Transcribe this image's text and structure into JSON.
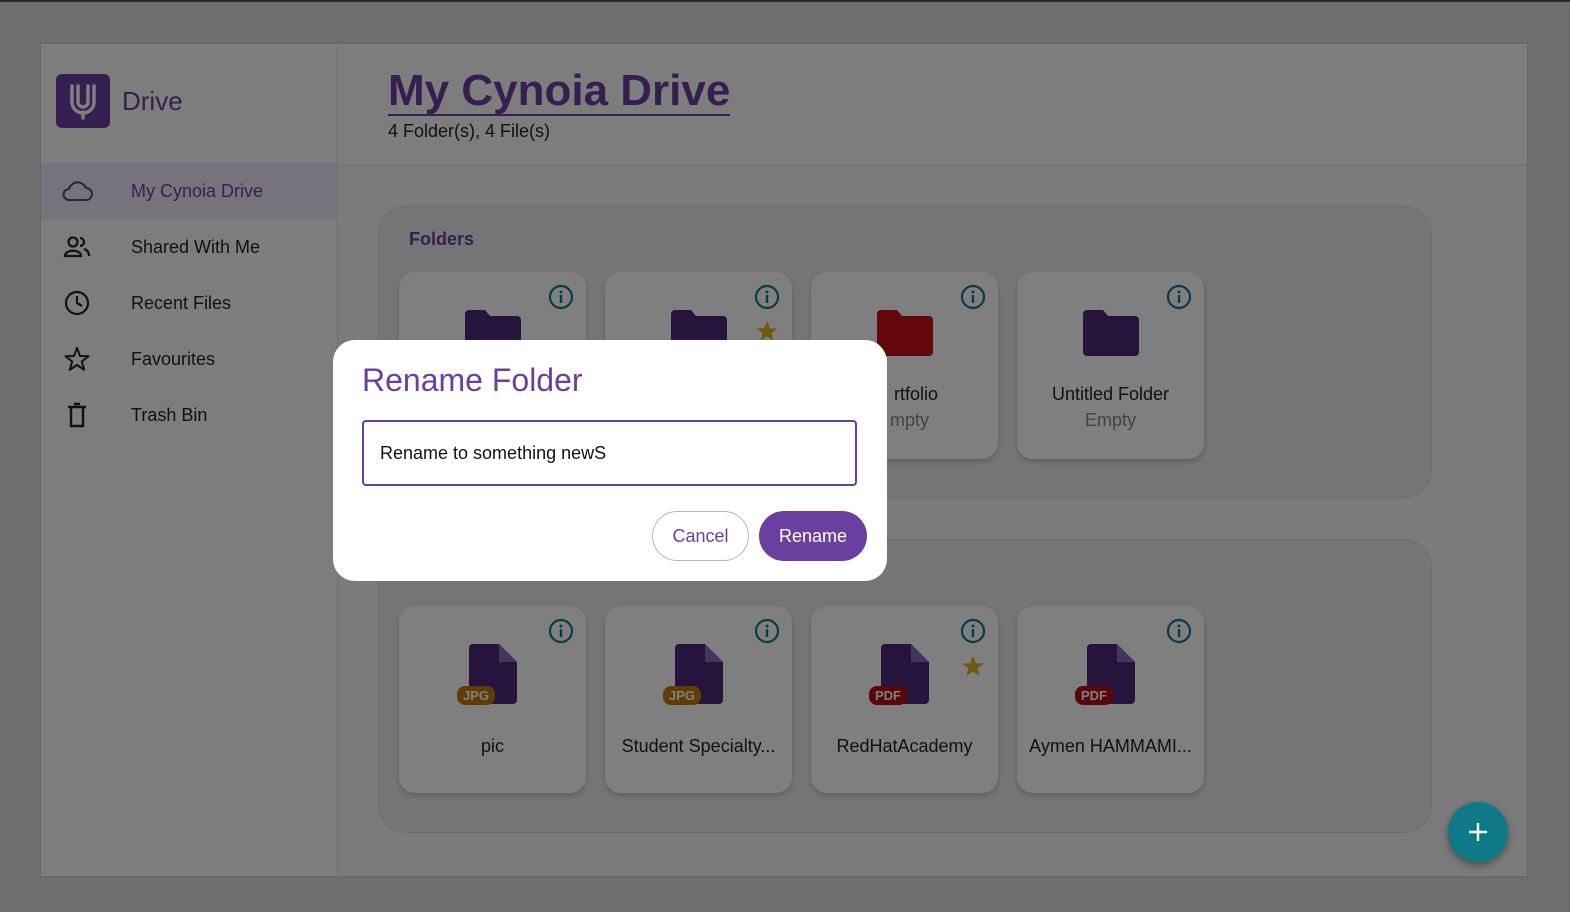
{
  "app": {
    "brand_name": "Drive"
  },
  "sidebar": {
    "items": [
      {
        "label": "My Cynoia Drive",
        "icon": "cloud-icon",
        "active": true
      },
      {
        "label": "Shared With Me",
        "icon": "people-icon",
        "active": false
      },
      {
        "label": "Recent Files",
        "icon": "clock-icon",
        "active": false
      },
      {
        "label": "Favourites",
        "icon": "star-outline-icon",
        "active": false
      },
      {
        "label": "Trash Bin",
        "icon": "trash-icon",
        "active": false
      }
    ]
  },
  "header": {
    "title": "My Cynoia Drive",
    "subtitle": "4 Folder(s), 4 File(s)"
  },
  "folders_section": {
    "title": "Folders",
    "folders": [
      {
        "name": "",
        "meta": "",
        "color": "#4a2878",
        "starred": false
      },
      {
        "name": "",
        "meta": "",
        "color": "#4a2878",
        "starred": true
      },
      {
        "name": "rtfolio",
        "meta": "mpty",
        "color": "#c80f14",
        "starred": false
      },
      {
        "name": "Untitled Folder",
        "meta": "Empty",
        "color": "#4a2878",
        "starred": false
      }
    ]
  },
  "files_section": {
    "files": [
      {
        "name": "pic",
        "type": "JPG",
        "badge_color": "#c17a0b",
        "starred": false
      },
      {
        "name": "Student Specialty...",
        "type": "JPG",
        "badge_color": "#c17a0b",
        "starred": false
      },
      {
        "name": "RedHatAcademy",
        "type": "PDF",
        "badge_color": "#b10e14",
        "starred": true
      },
      {
        "name": "Aymen HAMMAMI...",
        "type": "PDF",
        "badge_color": "#b10e14",
        "starred": false
      }
    ]
  },
  "dialog": {
    "title": "Rename Folder",
    "input_value": "Rename to something newS",
    "cancel_label": "Cancel",
    "rename_label": "Rename"
  },
  "colors": {
    "primary": "#6b3fa0",
    "info": "#0e7a88",
    "star": "#e0b22a",
    "fab": "#0e7a88"
  }
}
